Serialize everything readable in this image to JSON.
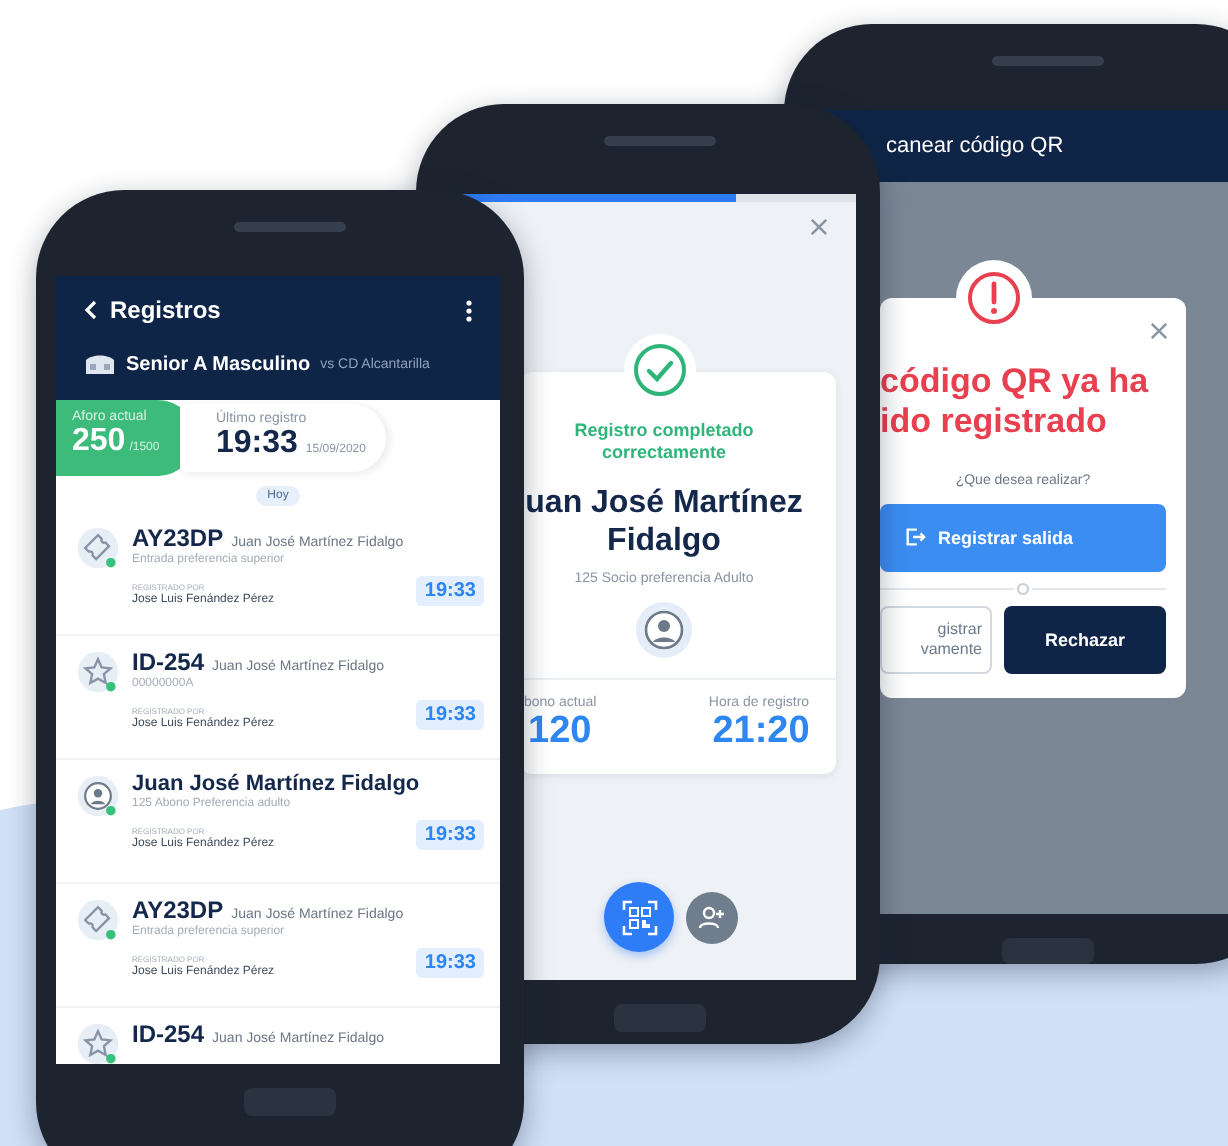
{
  "scan_screen": {
    "title": "canear código QR",
    "alert": {
      "title_lines": [
        "código QR ya ha",
        "ido registrado"
      ],
      "question": "¿Que desea realizar?",
      "primary_button": "Registrar salida",
      "secondary_button_lines": [
        "gistrar",
        "vamente"
      ],
      "reject_button": "Rechazar"
    }
  },
  "success_screen": {
    "progress": {
      "level": 0.71
    },
    "heading": "Registro completado correctamente",
    "name_lines": [
      "uan José Martínez",
      "Fidalgo"
    ],
    "subtitle": "125 Socio preferencia Adulto",
    "stats": [
      {
        "label": "bono actual",
        "value": "120"
      },
      {
        "label": "Hora de registro",
        "value": "21:20"
      }
    ]
  },
  "list_screen": {
    "title": "Registros",
    "team": "Senior A Masculino",
    "opponent": "vs CD Alcantarilla",
    "capacity": {
      "label": "Aforo actual",
      "value": "250",
      "total": "/1500"
    },
    "last_entry": {
      "label": "Último registro",
      "time": "19:33",
      "date": "15/09/2020"
    },
    "day": "Hoy",
    "records": [
      {
        "kind": "ticket",
        "title": "AY23DP",
        "name": "Juan José Martínez Fidalgo",
        "detail": "Entrada preferencia superior",
        "registered_by_label": "REGISTRADO POR",
        "registered_by": "Jose Luis Fenández Pérez",
        "time": "19:33"
      },
      {
        "kind": "star",
        "title": "ID-254",
        "name": "Juan José Martínez Fidalgo",
        "detail": "00000000A",
        "registered_by_label": "REGISTRADO POR",
        "registered_by": "Jose Luis Fenández Pérez",
        "time": "19:33"
      },
      {
        "kind": "person",
        "title": "Juan José Martínez Fidalgo",
        "detail": "125 Abono Preferencia adulto",
        "registered_by_label": "REGISTRADO POR",
        "registered_by": "Jose Luis Fenández Pérez",
        "time": "19:33"
      },
      {
        "kind": "ticket",
        "title": "AY23DP",
        "name": "Juan José Martínez Fidalgo",
        "detail": "Entrada preferencia superior",
        "registered_by_label": "REGISTRADO POR",
        "registered_by": "Jose Luis Fenández Pérez",
        "time": "19:33"
      },
      {
        "kind": "star",
        "title": "ID-254",
        "name": "Juan José Martínez Fidalgo"
      }
    ]
  }
}
